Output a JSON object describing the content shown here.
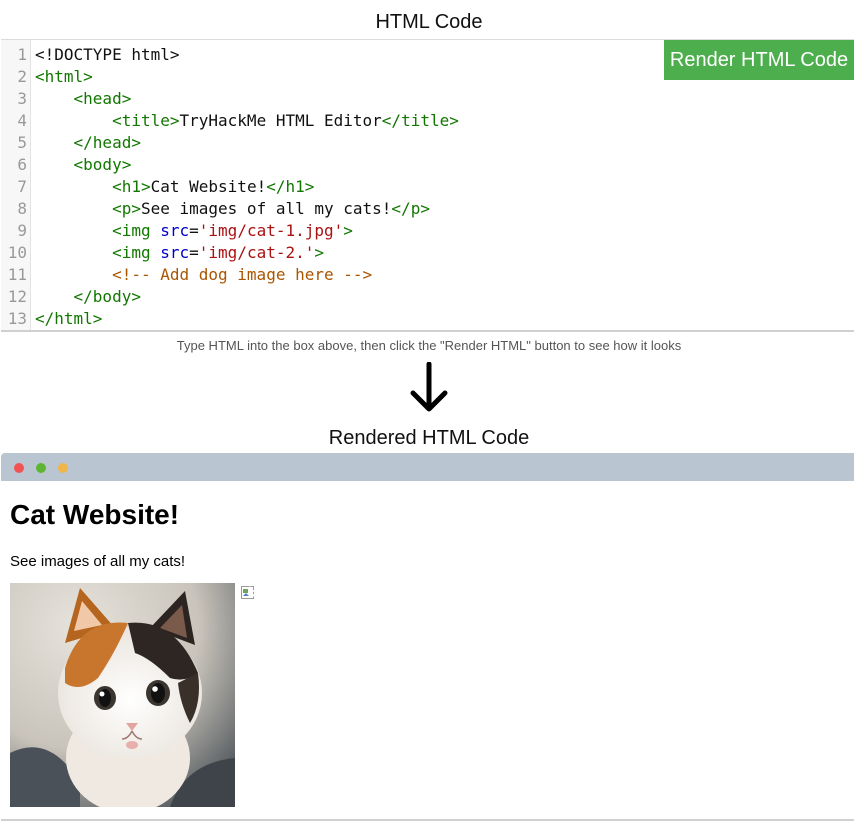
{
  "code_section": {
    "title": "HTML Code",
    "render_button_label": "Render HTML Code",
    "line_numbers": [
      "1",
      "2",
      "3",
      "4",
      "5",
      "6",
      "7",
      "8",
      "9",
      "10",
      "11",
      "12",
      "13"
    ],
    "lines": [
      "<!DOCTYPE html>",
      "<html>",
      "    <head>",
      "        <title>TryHackMe HTML Editor</title>",
      "    </head>",
      "    <body>",
      "        <h1>Cat Website!</h1>",
      "        <p>See images of all my cats!</p>",
      "        <img src='img/cat-1.jpg'>",
      "        <img src='img/cat-2.'>",
      "        <!-- Add dog image here -->",
      "    </body>",
      "</html>"
    ]
  },
  "hint_text": "Type HTML into the box above, then click the \"Render HTML\" button to see how it looks",
  "arrow_icon": "arrow-down-icon",
  "render_section": {
    "title": "Rendered HTML Code",
    "window_controls": [
      "close-dot",
      "maximize-dot",
      "minimize-dot"
    ],
    "window_colors": {
      "close": "#f25252",
      "maximize": "#5db531",
      "minimize": "#f1b648",
      "bar": "#b9c6d1"
    },
    "page_heading": "Cat Website!",
    "page_paragraph": "See images of all my cats!",
    "images": [
      {
        "alt": "cat-1",
        "icon": "kitten-photo"
      },
      {
        "alt": "cat-2",
        "icon": "broken-image-icon"
      }
    ]
  },
  "colors": {
    "button_bg": "#4cae4c",
    "tag": "#117700",
    "attr": "#0000cc",
    "string": "#aa1111",
    "comment": "#aa5500"
  }
}
